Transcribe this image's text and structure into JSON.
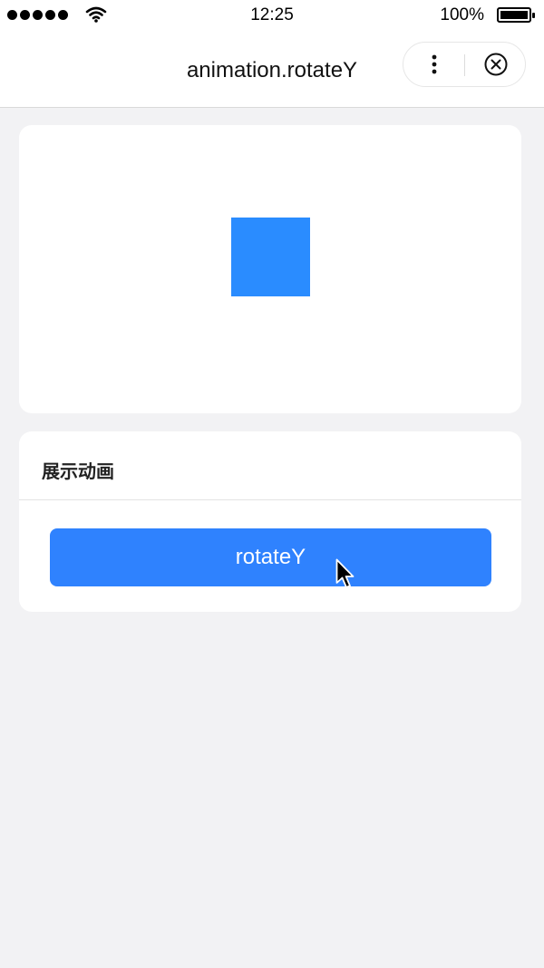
{
  "status_bar": {
    "time": "12:25",
    "battery_percent": "100%"
  },
  "nav": {
    "title": "animation.rotateY"
  },
  "demo": {
    "square_color": "#2a8cff"
  },
  "controls": {
    "section_title": "展示动画",
    "button_label": "rotateY",
    "button_color": "#2f82fe"
  }
}
